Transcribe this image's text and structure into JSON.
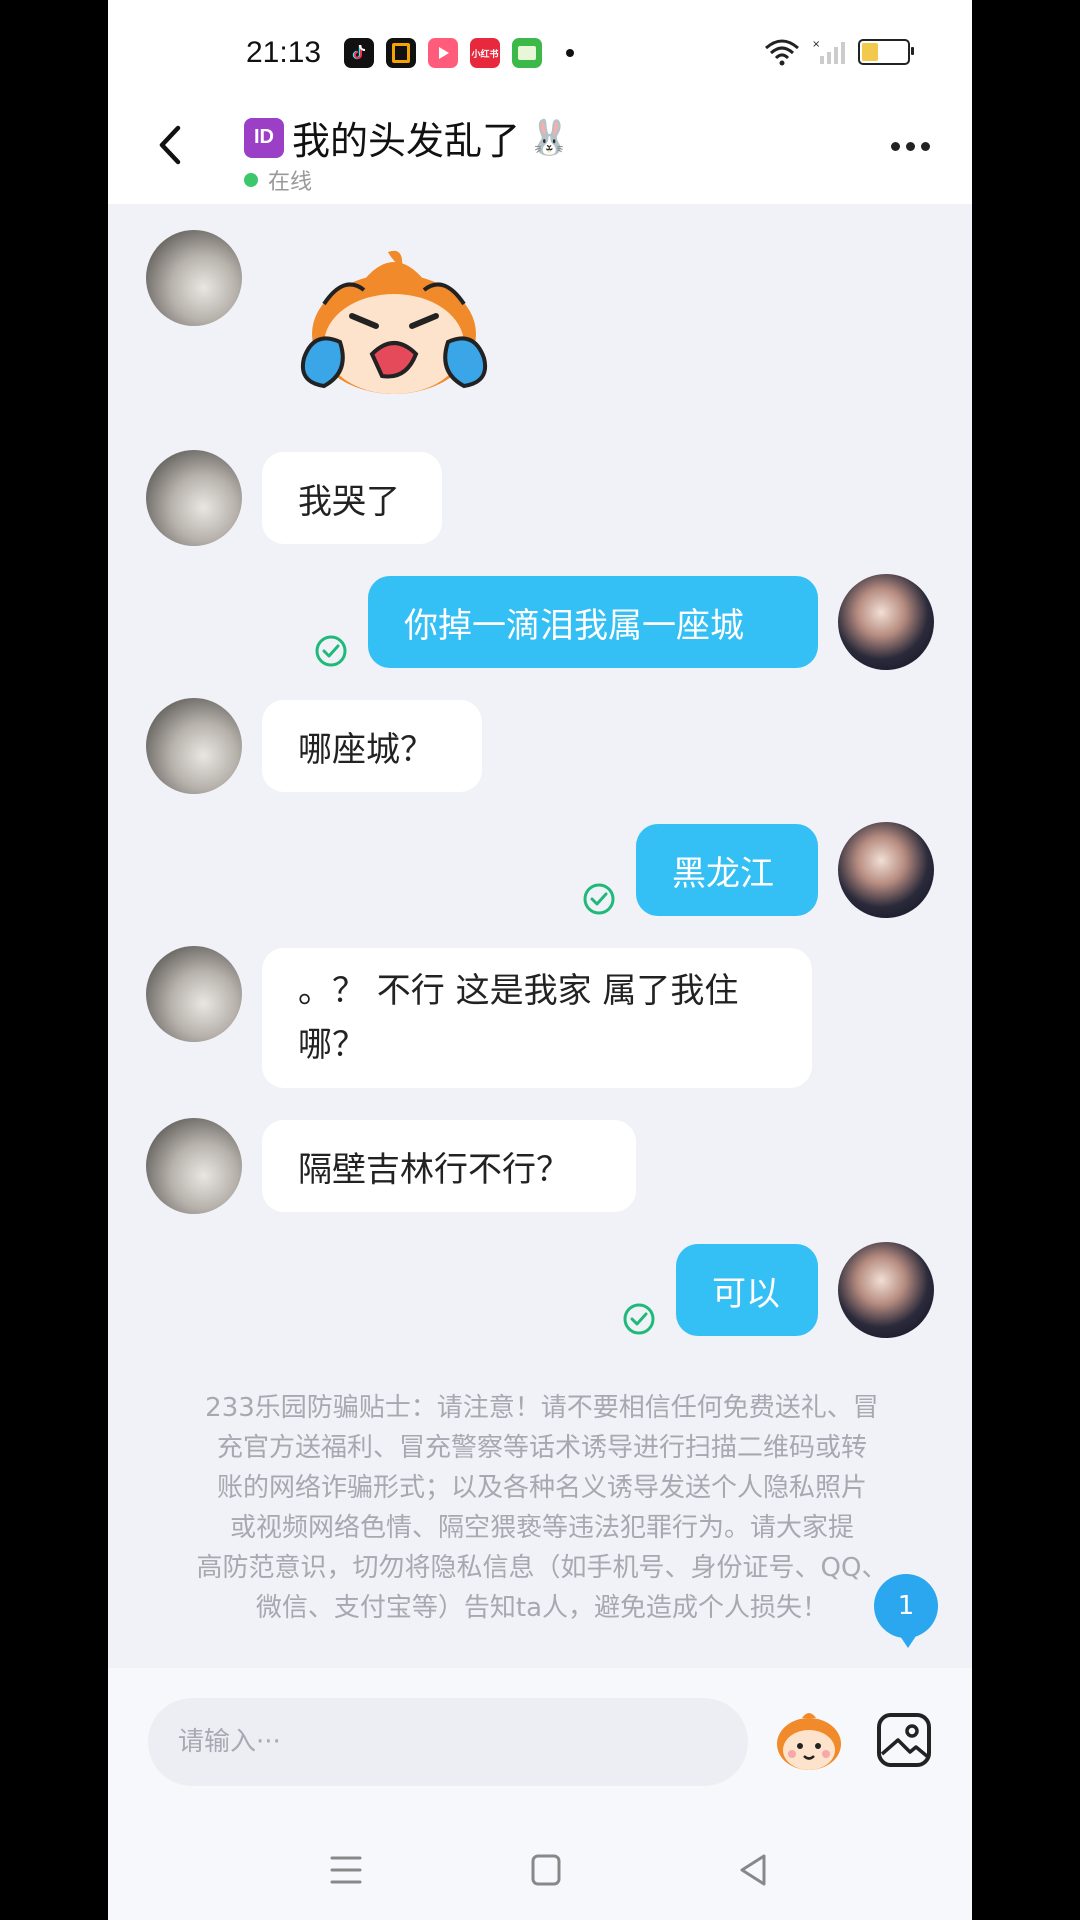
{
  "status_bar": {
    "time": "21:13",
    "apps": [
      {
        "name": "douyin",
        "color": "#111111",
        "label": ""
      },
      {
        "name": "app-black",
        "color": "#111111",
        "label": ""
      },
      {
        "name": "video",
        "color": "#ff4d6d",
        "label": ""
      },
      {
        "name": "xiaohongshu",
        "color": "#e8283c",
        "label": "小红书"
      },
      {
        "name": "game-center",
        "color": "#3db94a",
        "label": ""
      }
    ]
  },
  "header": {
    "badge": "ID",
    "title": "我的头发乱了",
    "title_emoji": "🐰",
    "presence": "在线"
  },
  "messages": [
    {
      "from": "them",
      "type": "sticker",
      "sticker": "crying-monkey"
    },
    {
      "from": "them",
      "type": "text",
      "text": "我哭了"
    },
    {
      "from": "me",
      "type": "text",
      "text": "你掉一滴泪我属一座城",
      "read": true
    },
    {
      "from": "them",
      "type": "text",
      "text": "哪座城？"
    },
    {
      "from": "me",
      "type": "text",
      "text": "黑龙江",
      "read": true
    },
    {
      "from": "them",
      "type": "text",
      "text_line1": "。？ 不行 这是我家 属了我住",
      "text_line2": "哪？"
    },
    {
      "from": "them",
      "type": "text",
      "text": "隔壁吉林行不行？"
    },
    {
      "from": "me",
      "type": "text",
      "text": "可以",
      "read": true
    }
  ],
  "notice": {
    "lines": [
      "233乐园防骗贴士：请注意！请不要相信任何免费送礼、冒",
      "充官方送福利、冒充警察等话术诱导进行扫描二维码或转",
      "账的网络诈骗形式；以及各种名义诱导发送个人隐私照片",
      "或视频网络色情、隔空猥亵等违法犯罪行为。请大家提",
      "高防范意识，切勿将隐私信息（如手机号、身份证号、QQ、",
      "微信、支付宝等）告知ta人，避免造成个人损失！"
    ]
  },
  "unread_count": "1",
  "input": {
    "placeholder": "请输入···"
  },
  "colors": {
    "my_bubble": "#34bff5",
    "read_check": "#1fb97a",
    "online": "#3cc76a"
  }
}
